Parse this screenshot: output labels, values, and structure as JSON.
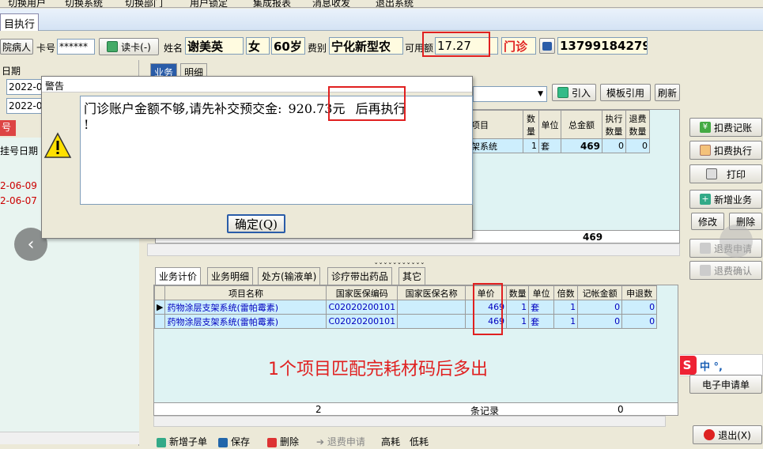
{
  "toolbar": {
    "items": [
      "切换用户",
      "切换系统",
      "切换部门",
      "用户锁定",
      "集成报表",
      "消息收发",
      "退出系统"
    ]
  },
  "window_tab": "目执行",
  "header": {
    "patient_type_button": "院病人",
    "card_label": "卡号",
    "card_value": "******",
    "read_card_button": "读卡(-)",
    "name_label": "姓名",
    "name_value": "谢美英",
    "gender_value": "女",
    "age_value": "60岁",
    "fee_label": "费别",
    "fee_value": "宁化新型农",
    "available_label": "可用额",
    "available_value": "17.27",
    "visit_type": "门诊",
    "phone_value": "13799184279"
  },
  "left_panel": {
    "date_title": "日期",
    "date_from": "2022-0",
    "date_to": "2022-0",
    "tab_label": "号",
    "reg_date_label": "挂号日期",
    "rows": [
      "2-06-09",
      "2-06-07"
    ]
  },
  "top_tabs": [
    "业务",
    "明细"
  ],
  "top_buttons": {
    "import": "引入",
    "template": "模板引用",
    "refresh": "刷新"
  },
  "top_grid": {
    "headers": [
      "项目",
      "数量",
      "单位",
      "总金额",
      "执行数量",
      "退费数量"
    ],
    "row": {
      "item": "架系统",
      "qty": "1",
      "unit": "套",
      "amount": "469",
      "exec": "0",
      "refund": "0"
    },
    "total": "469"
  },
  "right_buttons": {
    "deduct_record": "扣费记账",
    "deduct_exec": "扣费执行",
    "print": "打印",
    "add_business": "新增业务",
    "edit": "修改",
    "delete": "删除",
    "refund_apply": "退费申请",
    "refund_confirm": "退费确认",
    "e_apply": "电子申请单",
    "exit": "退出(X)"
  },
  "ime": {
    "logo": "S",
    "text": "中 °,"
  },
  "bottom_tabs": [
    "业务计价",
    "业务明细",
    "处方(输液单)",
    "诊疗带出药品",
    "其它"
  ],
  "bottom_grid": {
    "headers": [
      "项目名称",
      "国家医保编码",
      "国家医保名称",
      "单价",
      "数量",
      "单位",
      "倍数",
      "记帐金额",
      "申退数"
    ],
    "rows": [
      {
        "name": "药物涂层支架系统(雷帕霉素)",
        "code": "C02020200101",
        "natname": "",
        "price": "469",
        "qty": "1",
        "unit": "套",
        "mult": "1",
        "amount": "0",
        "refund": "0"
      },
      {
        "name": "药物涂层支架系统(雷帕霉素)",
        "code": "C02020200101",
        "natname": "",
        "price": "469",
        "qty": "1",
        "unit": "套",
        "mult": "1",
        "amount": "0",
        "refund": "0"
      }
    ],
    "footer_count": "2",
    "footer_label": "条记录",
    "footer_amount": "0"
  },
  "annotation": "1个项目匹配完耗材码后多出",
  "bottom_toolbar": [
    "新增子单",
    "保存",
    "删除",
    "退费申请",
    "高耗",
    "低耗"
  ],
  "dialog": {
    "title": "警告",
    "message_prefix": "门诊账户金额不够,请先补交预交金:",
    "amount": "920.73元",
    "message_suffix": " 后再执行",
    "message_line2": "!",
    "ok_button": "确定(Q)"
  },
  "colors": {
    "accent_red": "#e02020",
    "grid_blue_text": "#0000c0",
    "selected_row": "#cdeefd",
    "panel_bg": "#dff3f3",
    "left_list_bg": "#e8f4f0"
  }
}
